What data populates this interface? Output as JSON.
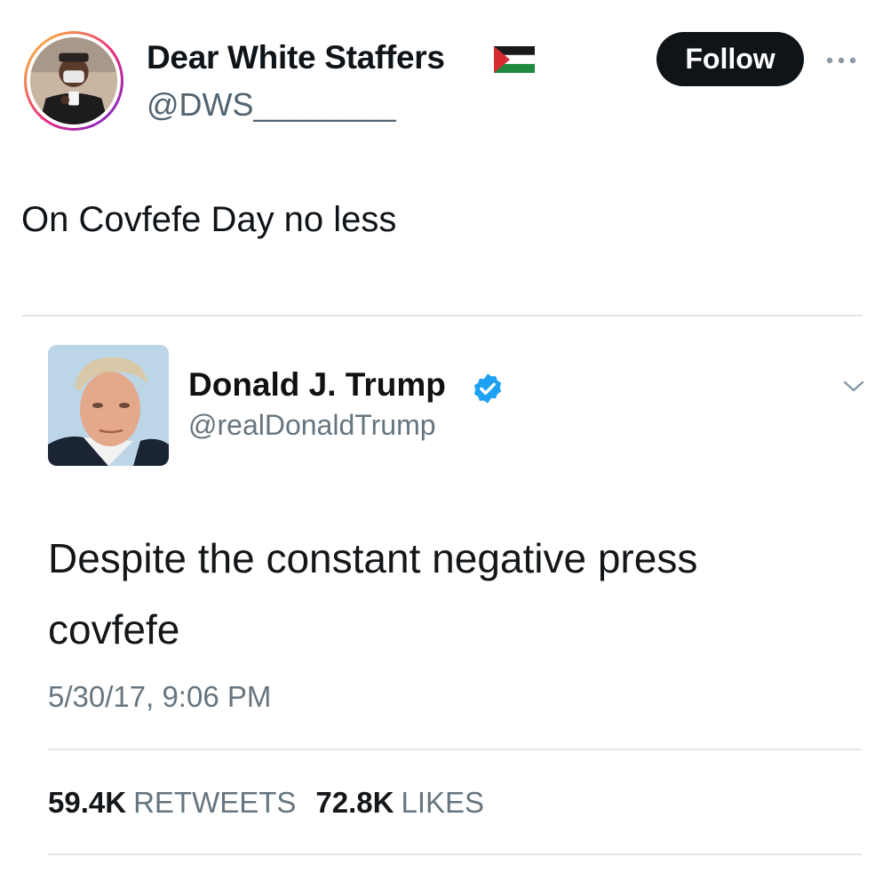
{
  "tweet": {
    "author": {
      "name": "Dear White Staffers",
      "handle": "@DWS________",
      "flag_icon": "palestine-flag-icon",
      "avatar_icon": "avatar-icon"
    },
    "follow_label": "Follow",
    "more_icon": "more-dots-icon",
    "text": "On Covfefe Day no less"
  },
  "quoted": {
    "author": {
      "name": "Donald J. Trump",
      "handle": "@realDonaldTrump",
      "verified_icon": "verified-badge-icon"
    },
    "caret_icon": "chevron-down-icon",
    "text": "Despite the constant negative press\ncovfefe",
    "timestamp": "5/30/17, 9:06 PM",
    "retweets_count": "59.4K",
    "retweets_label": "RETWEETS",
    "likes_count": "72.8K",
    "likes_label": "LIKES"
  },
  "colors": {
    "follow_bg": "#0f1419",
    "verified": "#1da1f2",
    "secondary_text": "#66757f",
    "divider": "#e1e8ed"
  }
}
